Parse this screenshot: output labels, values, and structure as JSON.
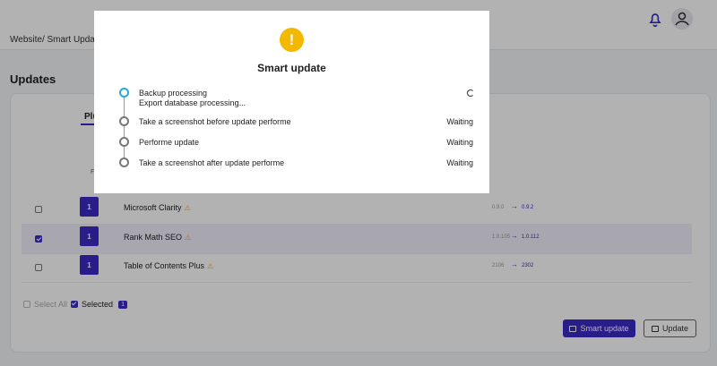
{
  "header": {
    "breadcrumb": "Website/ Smart Update"
  },
  "page": {
    "title": "Updates",
    "tab_label": "Plugins",
    "col_label": "F"
  },
  "plugins": [
    {
      "checked": false,
      "version_badge": "1",
      "name": "Microsoft Clarity",
      "from": "0.9.0",
      "to": "0.9.2"
    },
    {
      "checked": true,
      "version_badge": "1",
      "name": "Rank Math SEO",
      "from": "1.0.105",
      "to": "1.0.112"
    },
    {
      "checked": false,
      "version_badge": "1",
      "name": "Table of Contents Plus",
      "from": "2106",
      "to": "2302"
    }
  ],
  "footer": {
    "select_all_label": "Select All",
    "selected_label": "Selected",
    "selected_count": "1",
    "smart_update_label": "Smart update",
    "update_label": "Update"
  },
  "modal": {
    "title": "Smart update",
    "alert_glyph": "!",
    "steps": [
      {
        "label": "Backup processing",
        "sub": "Export database processing...",
        "status": "",
        "state": "in-progress"
      },
      {
        "label": "Take a screenshot before update performe",
        "status": "Waiting",
        "state": "waiting"
      },
      {
        "label": "Performe update",
        "status": "Waiting",
        "state": "waiting"
      },
      {
        "label": "Take a screenshot after update performe",
        "status": "Waiting",
        "state": "waiting"
      }
    ]
  },
  "colors": {
    "accent": "#3b2bc4",
    "warning": "#f5b800",
    "active_step": "#2ca6d9"
  },
  "icons": [
    "bell-icon",
    "user-icon",
    "alert-icon",
    "warning-icon",
    "arrow-right-icon",
    "spinner-icon"
  ]
}
